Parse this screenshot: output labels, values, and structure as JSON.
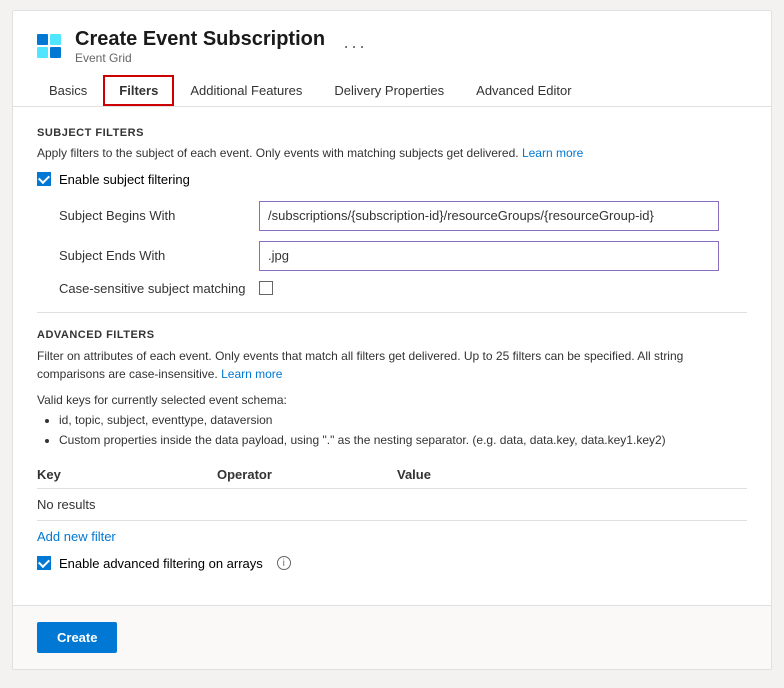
{
  "header": {
    "title": "Create Event Subscription",
    "subtitle": "Event Grid",
    "ellipsis": "···"
  },
  "tabs": [
    {
      "id": "basics",
      "label": "Basics",
      "active": false
    },
    {
      "id": "filters",
      "label": "Filters",
      "active": true
    },
    {
      "id": "additional-features",
      "label": "Additional Features",
      "active": false
    },
    {
      "id": "delivery-properties",
      "label": "Delivery Properties",
      "active": false
    },
    {
      "id": "advanced-editor",
      "label": "Advanced Editor",
      "active": false
    }
  ],
  "subject_filters": {
    "section_title": "SUBJECT FILTERS",
    "description": "Apply filters to the subject of each event. Only events with matching subjects get delivered.",
    "learn_more": "Learn more",
    "enable_label": "Enable subject filtering",
    "enable_checked": true,
    "begins_with_label": "Subject Begins With",
    "begins_with_value": "/subscriptions/{subscription-id}/resourceGroups/{resourceGroup-id}",
    "ends_with_label": "Subject Ends With",
    "ends_with_value": ".jpg",
    "case_sensitive_label": "Case-sensitive subject matching",
    "case_sensitive_checked": false
  },
  "advanced_filters": {
    "section_title": "ADVANCED FILTERS",
    "description": "Filter on attributes of each event. Only events that match all filters get delivered. Up to 25 filters can be specified. All string comparisons are case-insensitive.",
    "learn_more": "Learn more",
    "valid_keys_intro": "Valid keys for currently selected event schema:",
    "bullet_items": [
      "id, topic, subject, eventtype, dataversion",
      "Custom properties inside the data payload, using \".\" as the nesting separator. (e.g. data, data.key, data.key1.key2)"
    ],
    "table_columns": [
      "Key",
      "Operator",
      "Value"
    ],
    "no_results": "No results",
    "add_filter": "Add new filter",
    "enable_advanced_label": "Enable advanced filtering on arrays",
    "enable_advanced_checked": true
  },
  "footer": {
    "create_label": "Create"
  }
}
